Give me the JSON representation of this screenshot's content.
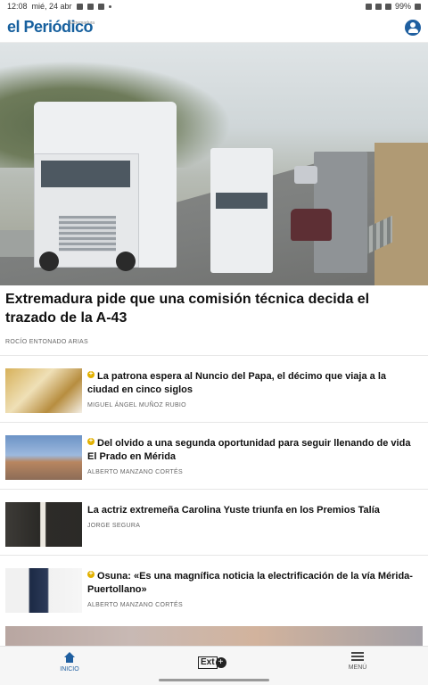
{
  "status_bar": {
    "time": "12:08",
    "date": "mié, 24 abr",
    "battery": "99%"
  },
  "header": {
    "logo": "el Periódico",
    "logo_sub": "Extremadura",
    "brand_color": "#17609e"
  },
  "hero": {
    "title": "Extremadura pide que una comisión técnica decida el trazado de la A-43",
    "author": "ROCÍO ENTONADO ARIAS"
  },
  "articles": [
    {
      "title": "La patrona espera al Nuncio del Papa, el décimo que viaja a la ciudad en cinco siglos",
      "author": "MIGUEL ÁNGEL MUÑOZ RUBIO",
      "premium": true
    },
    {
      "title": "Del olvido a una segunda oportunidad para seguir llenando de vida El Prado en Mérida",
      "author": "ALBERTO MANZANO CORTÉS",
      "premium": true
    },
    {
      "title": "La actriz extremeña Carolina Yuste triunfa en los Premios Talía",
      "author": "JORGE SEGURA",
      "premium": false
    },
    {
      "title": "Osuna: «Es una magnífica noticia la electrificación de la vía Mérida-Puertollano»",
      "author": "ALBERTO MANZANO CORTÉS",
      "premium": true
    }
  ],
  "bottom_nav": {
    "home_label": "INICIO",
    "extra_label": "Ext",
    "menu_label": "MENÚ",
    "accent_color": "#1f5fa0"
  }
}
